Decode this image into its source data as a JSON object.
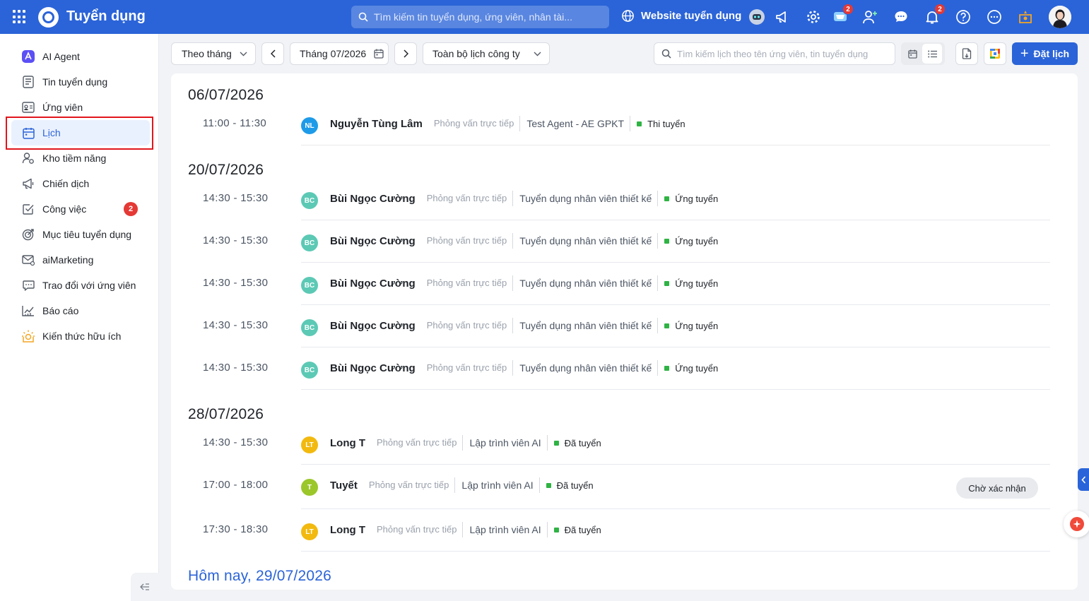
{
  "app": {
    "title": "Tuyển dụng"
  },
  "topbar": {
    "search_placeholder": "Tìm kiếm tin tuyển dụng, ứng viên, nhân tài...",
    "website_link": "Website tuyển dụng",
    "cart_badge": "2",
    "notif_badge": "2"
  },
  "sidebar": {
    "items": [
      {
        "label": "AI Agent",
        "icon": "ai-agent-icon"
      },
      {
        "label": "Tin tuyển dụng",
        "icon": "job-post-icon"
      },
      {
        "label": "Ứng viên",
        "icon": "candidate-card-icon"
      },
      {
        "label": "Lịch",
        "icon": "calendar-icon",
        "active": true
      },
      {
        "label": "Kho tiềm năng",
        "icon": "talent-pool-icon"
      },
      {
        "label": "Chiến dịch",
        "icon": "megaphone-icon"
      },
      {
        "label": "Công việc",
        "icon": "task-check-icon",
        "badge": "2"
      },
      {
        "label": "Mục tiêu tuyển dụng",
        "icon": "target-icon"
      },
      {
        "label": "aiMarketing",
        "icon": "mail-icon"
      },
      {
        "label": "Trao đổi với ứng viên",
        "icon": "chat-icon"
      },
      {
        "label": "Báo cáo",
        "icon": "report-chart-icon"
      },
      {
        "label": "Kiến thức hữu ích",
        "icon": "lightbulb-icon"
      }
    ]
  },
  "toolbar": {
    "view_mode": "Theo tháng",
    "current_month": "Tháng 07/2026",
    "scope": "Toàn bộ lịch công ty",
    "search_placeholder": "Tìm kiếm lịch theo tên ứng viên, tin tuyển dụng",
    "book_button": "Đặt lịch"
  },
  "schedule": {
    "days": [
      {
        "date": "06/07/2026",
        "events": [
          {
            "time": "11:00 - 11:30",
            "initials": "NL",
            "avatar_color": "#1e9be8",
            "name": "Nguyễn Tùng Lâm",
            "type": "Phỏng vấn trực tiếp",
            "job": "Test Agent - AE GPKT",
            "stage": "Thi tuyển"
          }
        ]
      },
      {
        "date": "20/07/2026",
        "events": [
          {
            "time": "14:30 - 15:30",
            "initials": "BC",
            "avatar_color": "#5cc9b5",
            "name": "Bùi Ngọc Cường",
            "type": "Phỏng vấn trực tiếp",
            "job": "Tuyển dụng nhân viên thiết kế",
            "stage": "Ứng tuyển"
          },
          {
            "time": "14:30 - 15:30",
            "initials": "BC",
            "avatar_color": "#5cc9b5",
            "name": "Bùi Ngọc Cường",
            "type": "Phỏng vấn trực tiếp",
            "job": "Tuyển dụng nhân viên thiết kế",
            "stage": "Ứng tuyển"
          },
          {
            "time": "14:30 - 15:30",
            "initials": "BC",
            "avatar_color": "#5cc9b5",
            "name": "Bùi Ngọc Cường",
            "type": "Phỏng vấn trực tiếp",
            "job": "Tuyển dụng nhân viên thiết kế",
            "stage": "Ứng tuyển"
          },
          {
            "time": "14:30 - 15:30",
            "initials": "BC",
            "avatar_color": "#5cc9b5",
            "name": "Bùi Ngọc Cường",
            "type": "Phỏng vấn trực tiếp",
            "job": "Tuyển dụng nhân viên thiết kế",
            "stage": "Ứng tuyển"
          },
          {
            "time": "14:30 - 15:30",
            "initials": "BC",
            "avatar_color": "#5cc9b5",
            "name": "Bùi Ngọc Cường",
            "type": "Phỏng vấn trực tiếp",
            "job": "Tuyển dụng nhân viên thiết kế",
            "stage": "Ứng tuyển"
          }
        ]
      },
      {
        "date": "28/07/2026",
        "events": [
          {
            "time": "14:30 - 15:30",
            "initials": "LT",
            "avatar_color": "#f2b90f",
            "name": "Long T",
            "type": "Phỏng vấn trực tiếp",
            "job": "Lập trình viên AI",
            "stage": "Đã tuyển"
          },
          {
            "time": "17:00 - 18:00",
            "initials": "T",
            "avatar_color": "#9bc72a",
            "name": "Tuyết",
            "type": "Phỏng vấn trực tiếp",
            "job": "Lập trình viên AI",
            "stage": "Đã tuyển",
            "action": "Chờ xác nhận"
          },
          {
            "time": "17:30 - 18:30",
            "initials": "LT",
            "avatar_color": "#f2b90f",
            "name": "Long T",
            "type": "Phỏng vấn trực tiếp",
            "job": "Lập trình viên AI",
            "stage": "Đã tuyển"
          }
        ]
      }
    ],
    "today_label": "Hôm nay, 29/07/2026"
  },
  "colors": {
    "brand": "#2b64d8",
    "stage_dot": "#2fb344",
    "badge": "#e53935"
  }
}
